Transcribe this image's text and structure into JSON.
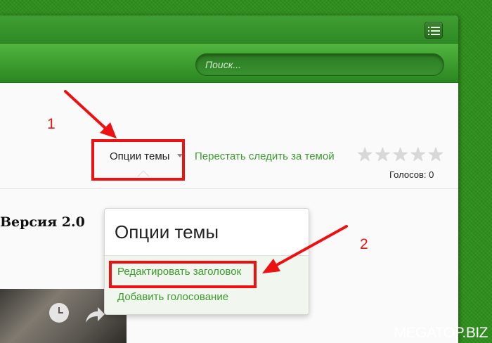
{
  "search": {
    "placeholder": "Поиск..."
  },
  "thread_tools": {
    "options_label": "Опции темы",
    "unsubscribe_label": "Перестать следить за темой",
    "rating": {
      "stars": 5,
      "filled": 0
    },
    "votes_label": "Голосов: 0"
  },
  "post": {
    "title_fragment": "Версия 2.0"
  },
  "dropdown": {
    "title": "Опции темы",
    "items": [
      {
        "label": "Редактировать заголовок"
      },
      {
        "label": "Добавить голосование"
      }
    ]
  },
  "annotations": {
    "step1": "1",
    "step2": "2",
    "highlight_color": "#ee1111"
  },
  "watermark": "MEGATOP.BIZ",
  "colors": {
    "brand_green": "#2f8a25",
    "link_green": "#3a9c2c"
  }
}
